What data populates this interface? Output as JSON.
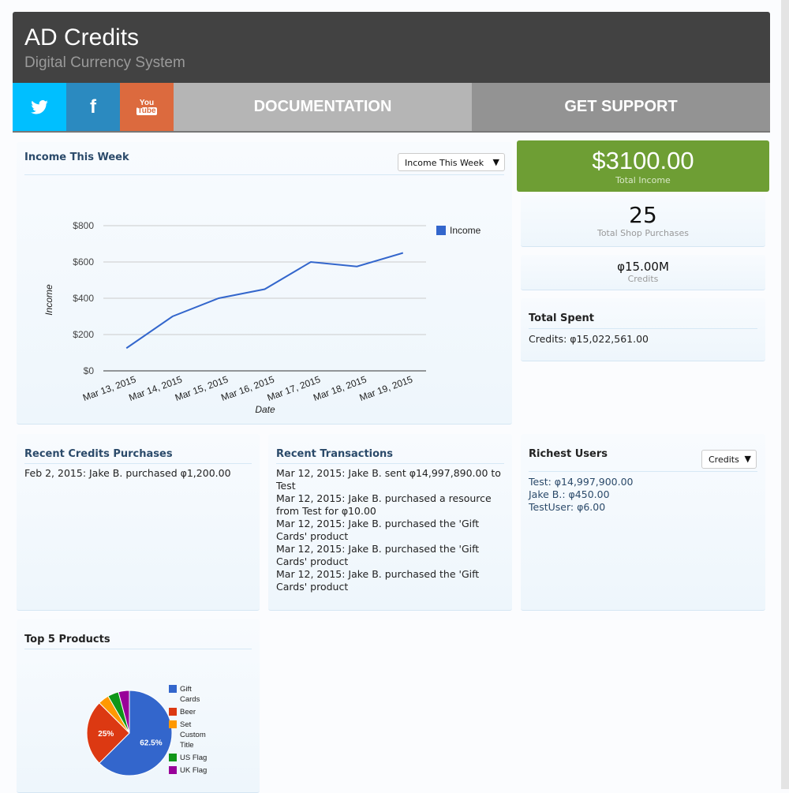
{
  "header": {
    "title": "AD Credits",
    "subtitle": "Digital Currency System"
  },
  "nav": {
    "twitter_icon": "twitter-icon",
    "facebook_icon": "facebook-icon",
    "youtube_icon": "youtube-icon",
    "youtube_text_1": "You",
    "youtube_text_2": "Tube",
    "documentation": "DOCUMENTATION",
    "support": "GET SUPPORT"
  },
  "income_panel": {
    "title": "Income This Week",
    "select": "Income This Week"
  },
  "stats": {
    "total_income": "$3100.00",
    "total_income_label": "Total Income",
    "purchases": "25",
    "purchases_label": "Total Shop Purchases",
    "credits": "φ15.00M",
    "credits_label": "Credits",
    "total_spent_title": "Total Spent",
    "total_spent": "Credits: φ15,022,561.00"
  },
  "recent_purchases": {
    "title": "Recent Credits Purchases",
    "items": [
      "Feb 2, 2015: Jake B. purchased φ1,200.00"
    ]
  },
  "recent_transactions": {
    "title": "Recent Transactions",
    "items": [
      "Mar 12, 2015: Jake B. sent φ14,997,890.00 to Test",
      "Mar 12, 2015: Jake B. purchased a resource from Test for φ10.00",
      "Mar 12, 2015: Jake B. purchased the 'Gift Cards' product",
      "Mar 12, 2015: Jake B. purchased the 'Gift Cards' product",
      "Mar 12, 2015: Jake B. purchased the 'Gift Cards' product"
    ]
  },
  "richest": {
    "title": "Richest Users",
    "select": "Credits",
    "items": [
      "Test: φ14,997,900.00",
      "Jake B.: φ450.00",
      "TestUser: φ6.00"
    ]
  },
  "products": {
    "title": "Top 5 Products"
  },
  "chart_data": [
    {
      "type": "line",
      "xlabel": "Date",
      "ylabel": "Income",
      "categories": [
        "Mar 13, 2015",
        "Mar 14, 2015",
        "Mar 15, 2015",
        "Mar 16, 2015",
        "Mar 17, 2015",
        "Mar 18, 2015",
        "Mar 19, 2015"
      ],
      "series": [
        {
          "name": "Income",
          "values": [
            125,
            300,
            400,
            450,
            600,
            575,
            650
          ],
          "color": "#3366cc"
        }
      ],
      "ylim": [
        0,
        800
      ],
      "yticks": [
        "$0",
        "$200",
        "$400",
        "$600",
        "$800"
      ],
      "grid": true,
      "legend": "right"
    },
    {
      "type": "pie",
      "categories": [
        "Gift Cards",
        "Beer",
        "Set Custom Title",
        "US Flag",
        "UK Flag"
      ],
      "values": [
        62.5,
        25,
        4.17,
        4.17,
        4.17
      ],
      "labels": [
        "62.5%",
        "25%",
        "",
        "",
        ""
      ],
      "colors": [
        "#3366cc",
        "#dc3912",
        "#ff9900",
        "#109618",
        "#990099"
      ],
      "legend": "right"
    }
  ]
}
